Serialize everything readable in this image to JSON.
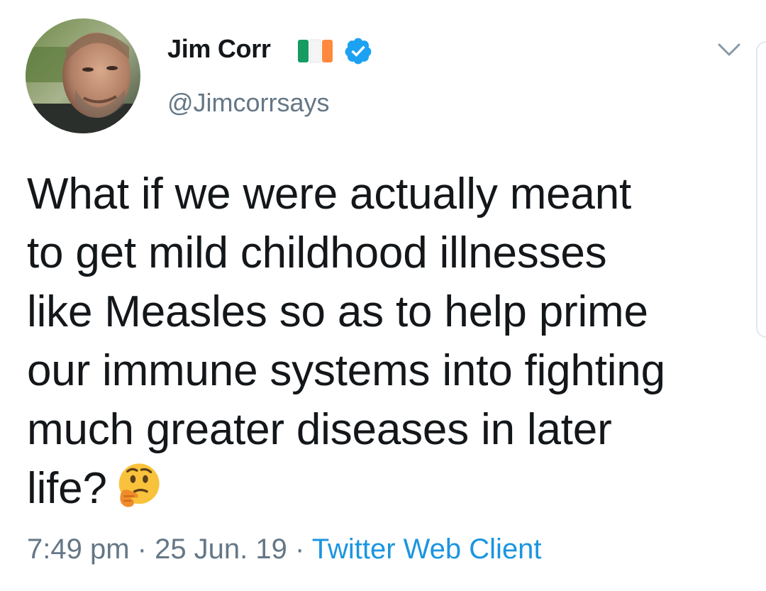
{
  "user": {
    "display_name": "Jim Corr",
    "handle": "@Jimcorrsays",
    "flag_icon": "ireland-flag-icon",
    "verified_icon": "verified-badge-icon",
    "flag_colors": [
      "#169b62",
      "#ffffff",
      "#ff883e"
    ],
    "verified_color": "#1da1f2"
  },
  "tweet": {
    "text_lines": [
      "What if we were actually meant",
      "to get mild childhood illnesses",
      "like Measles so as to help prime",
      "our immune systems into fighting",
      "much greater diseases in later",
      "life?"
    ],
    "emoji": "thinking-face-icon"
  },
  "meta": {
    "time": "7:49 pm",
    "separator": " · ",
    "date": "25 Jun. 19",
    "source": "Twitter Web Client"
  },
  "menu": {
    "icon": "chevron-down-icon"
  },
  "colors": {
    "text": "#14171a",
    "secondary": "#657786",
    "link": "#1b95e0"
  }
}
